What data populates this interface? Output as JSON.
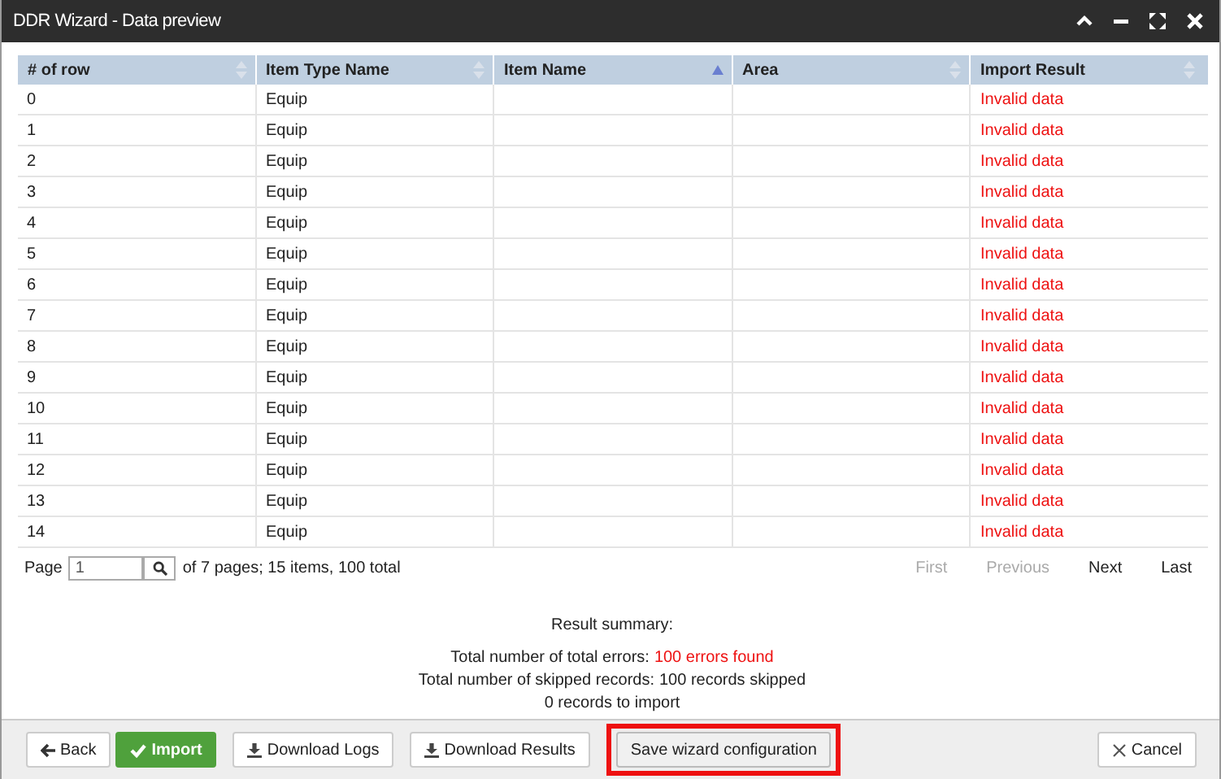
{
  "window": {
    "title": "DDR Wizard - Data preview"
  },
  "table": {
    "columns": [
      {
        "label": "# of row",
        "sorted": false
      },
      {
        "label": "Item Type Name",
        "sorted": false
      },
      {
        "label": "Item Name",
        "sorted": true
      },
      {
        "label": "Area",
        "sorted": false
      },
      {
        "label": "Import Result",
        "sorted": false
      }
    ],
    "rows": [
      [
        "0",
        "Equip",
        "",
        "",
        "Invalid data"
      ],
      [
        "1",
        "Equip",
        "",
        "",
        "Invalid data"
      ],
      [
        "2",
        "Equip",
        "",
        "",
        "Invalid data"
      ],
      [
        "3",
        "Equip",
        "",
        "",
        "Invalid data"
      ],
      [
        "4",
        "Equip",
        "",
        "",
        "Invalid data"
      ],
      [
        "5",
        "Equip",
        "",
        "",
        "Invalid data"
      ],
      [
        "6",
        "Equip",
        "",
        "",
        "Invalid data"
      ],
      [
        "7",
        "Equip",
        "",
        "",
        "Invalid data"
      ],
      [
        "8",
        "Equip",
        "",
        "",
        "Invalid data"
      ],
      [
        "9",
        "Equip",
        "",
        "",
        "Invalid data"
      ],
      [
        "10",
        "Equip",
        "",
        "",
        "Invalid data"
      ],
      [
        "11",
        "Equip",
        "",
        "",
        "Invalid data"
      ],
      [
        "12",
        "Equip",
        "",
        "",
        "Invalid data"
      ],
      [
        "13",
        "Equip",
        "",
        "",
        "Invalid data"
      ],
      [
        "14",
        "Equip",
        "",
        "",
        "Invalid data"
      ]
    ]
  },
  "pager": {
    "label": "Page",
    "value": "1",
    "info": "of 7 pages; 15 items, 100 total",
    "links": [
      {
        "label": "First",
        "disabled": true
      },
      {
        "label": "Previous",
        "disabled": true
      },
      {
        "label": "Next",
        "disabled": false
      },
      {
        "label": "Last",
        "disabled": false
      }
    ]
  },
  "summary": {
    "title": "Result summary:",
    "lines": [
      {
        "label": "Total number of total errors:",
        "value": "100 errors found",
        "error": true
      },
      {
        "label": "Total number of skipped records:",
        "value": "100 records skipped",
        "error": false
      },
      {
        "value": "0 records to import",
        "error": false
      }
    ]
  },
  "footer": {
    "buttons": [
      {
        "label": "Back",
        "kind": "back",
        "highlighted": false
      },
      {
        "label": "Import",
        "kind": "primary",
        "highlighted": false
      },
      {
        "label": "Download Logs",
        "kind": "download",
        "highlighted": false
      },
      {
        "label": "Download Results",
        "kind": "download",
        "highlighted": false
      },
      {
        "label": "Save wizard configuration",
        "kind": "plain",
        "highlighted": true
      }
    ],
    "cancel": "Cancel"
  }
}
